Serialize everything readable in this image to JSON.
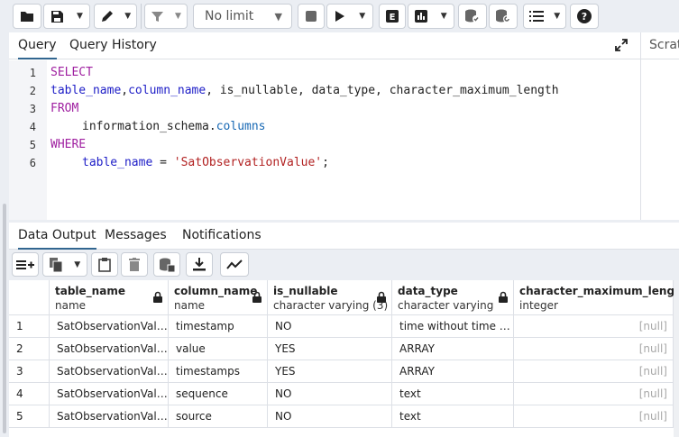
{
  "toolbar": {
    "limit_label": "No limit"
  },
  "query_panel": {
    "tabs": [
      {
        "label": "Query",
        "active": true
      },
      {
        "label": "Query History",
        "active": false
      }
    ],
    "scratch_label": "Scrat",
    "line_numbers": [
      "1",
      "2",
      "3",
      "4",
      "5",
      "6"
    ],
    "code": {
      "select_kw": "SELECT",
      "line2_table_name": "table_name",
      "line2_comma": ",",
      "line2_column_name": "column_name",
      "line2_rest": ", is_nullable, data_type, character_maximum_length",
      "from_kw": "FROM",
      "line4_schema": "information_schema",
      "line4_dot": ".",
      "line4_columns": "columns",
      "where_kw": "WHERE",
      "line6_col": "table_name",
      "line6_op": " = ",
      "line6_value": "'SatObservationValue'",
      "line6_end": ";"
    }
  },
  "output_panel": {
    "tabs": [
      {
        "label": "Data Output",
        "active": true
      },
      {
        "label": "Messages",
        "active": false
      },
      {
        "label": "Notifications",
        "active": false
      }
    ],
    "columns": [
      {
        "name": "table_name",
        "type": "name"
      },
      {
        "name": "column_name",
        "type": "name"
      },
      {
        "name": "is_nullable",
        "type": "character varying (3)"
      },
      {
        "name": "data_type",
        "type": "character varying"
      },
      {
        "name": "character_maximum_length",
        "type": "integer"
      }
    ],
    "rows": [
      {
        "num": "1",
        "cells": [
          "SatObservationValue",
          "timestamp",
          "NO",
          "time without time zone",
          "[null]"
        ]
      },
      {
        "num": "2",
        "cells": [
          "SatObservationValue",
          "value",
          "YES",
          "ARRAY",
          "[null]"
        ]
      },
      {
        "num": "3",
        "cells": [
          "SatObservationValue",
          "timestamps",
          "YES",
          "ARRAY",
          "[null]"
        ]
      },
      {
        "num": "4",
        "cells": [
          "SatObservationValue",
          "sequence",
          "NO",
          "text",
          "[null]"
        ]
      },
      {
        "num": "5",
        "cells": [
          "SatObservationValue",
          "source",
          "NO",
          "text",
          "[null]"
        ]
      }
    ]
  },
  "colors": {
    "keyword": "#9f1fa0",
    "identifier": "#1d1dc7",
    "string": "#b22222",
    "accent": "#326690",
    "null_text": "#a8a8a8"
  }
}
